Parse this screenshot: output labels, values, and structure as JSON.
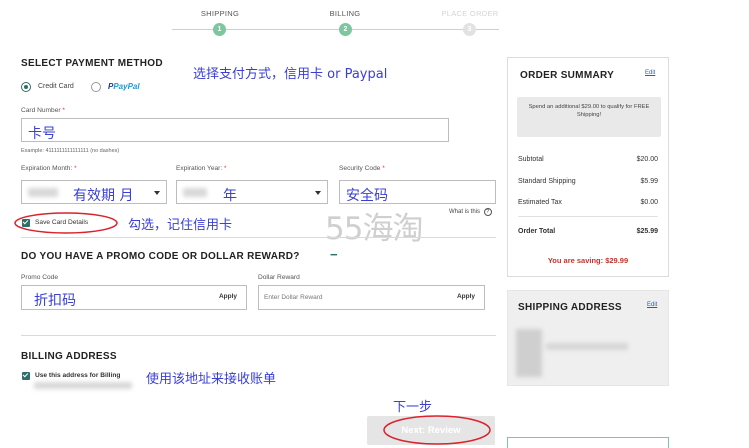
{
  "steps": [
    {
      "label": "SHIPPING",
      "number": "1",
      "state": "done"
    },
    {
      "label": "BILLING",
      "number": "2",
      "state": "active"
    },
    {
      "label": "PLACE ORDER",
      "number": "3",
      "state": "pending"
    }
  ],
  "payment": {
    "title": "SELECT PAYMENT METHOD",
    "annotation": "选择支付方式，信用卡 or Paypal",
    "credit_card_label": "Credit Card",
    "paypal_label": "PayPal",
    "card_number_label": "Card Number",
    "required_mark": "*",
    "card_number_value": "卡号",
    "card_example": "Example: 4111111111111111 (no dashes)",
    "exp_month_label": "Expiration Month:",
    "exp_month_value": "有效期 月",
    "exp_year_label": "Expiration Year:",
    "exp_year_value": "年",
    "security_label": "Security Code",
    "security_value": "安全码",
    "save_card_label": "Save Card Details",
    "save_card_annotation": "勾选，记住信用卡",
    "what_is_this": "What is this",
    "help_icon_glyph": "?"
  },
  "watermark": "55海淘",
  "promo": {
    "title": "DO YOU HAVE A PROMO CODE OR DOLLAR REWARD?",
    "toggle_glyph": "−",
    "promo_label": "Promo Code",
    "promo_value": "折扣码",
    "apply_label": "Apply",
    "reward_label": "Dollar Reward",
    "reward_placeholder": "Enter Dollar Reward",
    "reward_apply_label": "Apply"
  },
  "billing": {
    "title": "BILLING ADDRESS",
    "use_address_label": "Use this address for Billing",
    "annotation": "使用该地址来接收账单"
  },
  "next": {
    "annotation": "下一步",
    "button_label": "Next: Review"
  },
  "summary": {
    "title": "ORDER SUMMARY",
    "edit": "Edit",
    "promo_note": "Spend an additional $29.00 to qualify for FREE Shipping!",
    "rows": [
      {
        "label": "Subtotal",
        "amount": "$20.00"
      },
      {
        "label": "Standard Shipping",
        "amount": "$5.99"
      },
      {
        "label": "Estimated Tax",
        "amount": "$0.00"
      }
    ],
    "total_label": "Order Total",
    "total_amount": "$25.99",
    "saving_text": "You are saving: $29.99"
  },
  "shipping_address": {
    "title": "SHIPPING ADDRESS",
    "edit": "Edit"
  },
  "colors": {
    "step_green": "#7cc6a0",
    "annotation_blue": "#3a3fd6",
    "highlight_red": "#d9232d",
    "checkbox_teal": "#2f6f6a",
    "saving_red": "#c8312b"
  }
}
